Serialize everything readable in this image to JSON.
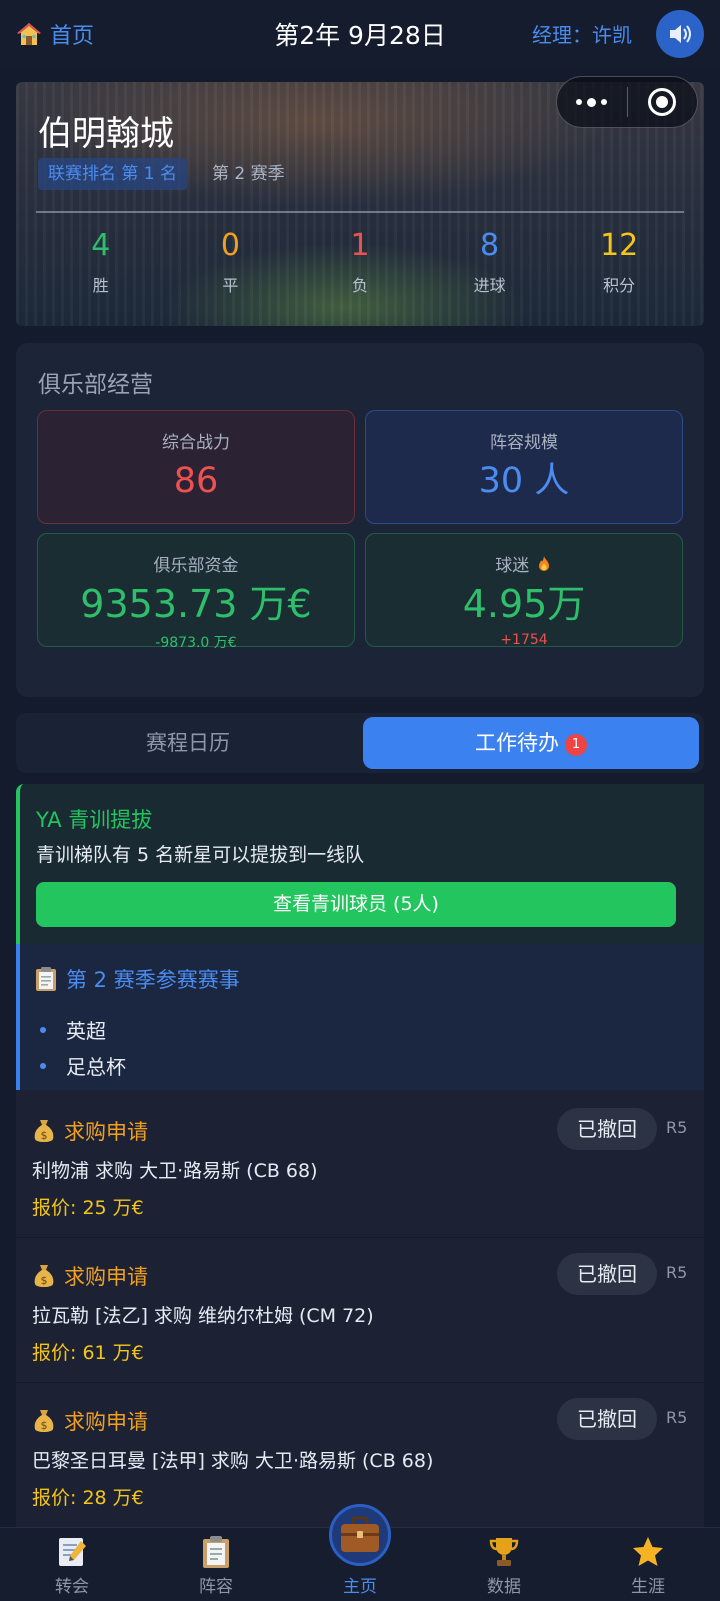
{
  "topbar": {
    "home_label": "首页",
    "date": "第2年 9月28日",
    "manager": "经理：许凯"
  },
  "club": {
    "name": "伯明翰城",
    "rank": "联赛排名 第 1 名",
    "season": "第 2 赛季",
    "stats": [
      {
        "value": "4",
        "label": "胜",
        "color": "#2fbf6b"
      },
      {
        "value": "0",
        "label": "平",
        "color": "#f0a020"
      },
      {
        "value": "1",
        "label": "负",
        "color": "#ef5050"
      },
      {
        "value": "8",
        "label": "进球",
        "color": "#4a8cf0"
      },
      {
        "value": "12",
        "label": "积分",
        "color": "#f5c518"
      }
    ]
  },
  "management": {
    "title": "俱乐部经营",
    "power": {
      "label": "综合战力",
      "value": "86"
    },
    "squad": {
      "label": "阵容规模",
      "value": "30 人"
    },
    "funds": {
      "label": "俱乐部资金",
      "value": "9353.73 万€",
      "change": "-9873.0 万€"
    },
    "fans": {
      "label": "球迷",
      "value": "4.95万",
      "change": "+1754"
    }
  },
  "tabs": {
    "calendar": "赛程日历",
    "todo": "工作待办",
    "todo_badge": "1"
  },
  "youth": {
    "title": "YA 青训提拔",
    "text": "青训梯队有 5 名新星可以提拔到一线队",
    "button": "查看青训球员 (5人)"
  },
  "season_comp": {
    "title": "第 2 赛季参赛赛事",
    "items": [
      "英超",
      "足总杯"
    ]
  },
  "offers": [
    {
      "title": "求购申请",
      "text": "利物浦 求购 大卫·路易斯 (CB 68)",
      "price": "报价: 25 万€",
      "status": "已撤回",
      "round": "R5"
    },
    {
      "title": "求购申请",
      "text": "拉瓦勒 [法乙] 求购 维纳尔杜姆 (CM 72)",
      "price": "报价: 61 万€",
      "status": "已撤回",
      "round": "R5"
    },
    {
      "title": "求购申请",
      "text": "巴黎圣日耳曼 [法甲] 求购 大卫·路易斯 (CB 68)",
      "price": "报价: 28 万€",
      "status": "已撤回",
      "round": "R5"
    }
  ],
  "nav": {
    "transfer": "转会",
    "squad": "阵容",
    "home": "主页",
    "data": "数据",
    "career": "生涯"
  },
  "icons": {
    "home": "house-icon",
    "sound": "speaker-icon",
    "fire": "fire-icon",
    "money_bag": "money-bag-icon",
    "clipboard": "clipboard-icon",
    "briefcase": "briefcase-icon",
    "trophy": "trophy-icon",
    "star": "star-icon",
    "memo": "memo-icon"
  }
}
